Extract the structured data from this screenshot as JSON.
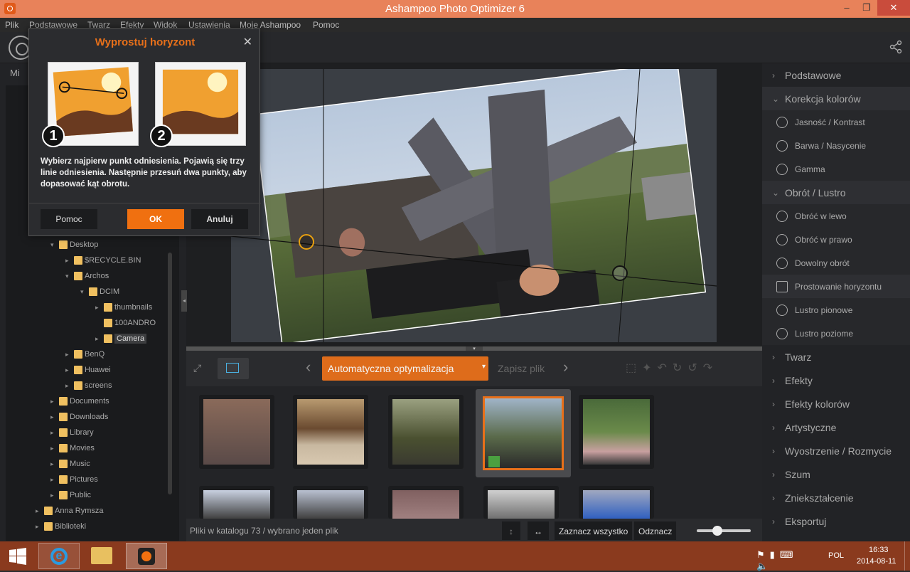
{
  "window": {
    "title": "Ashampoo Photo Optimizer 6"
  },
  "menu": [
    "Plik",
    "Podstawowe",
    "Twarz",
    "Efekty",
    "Widok",
    "Ustawienia",
    "Moje Ashampoo",
    "Pomoc"
  ],
  "dialog": {
    "title": "Wyprostuj horyzont",
    "step1": "1",
    "step2": "2",
    "text": "Wybierz najpierw punkt odniesienia. Pojawią się trzy linie odniesienia. Następnie przesuń dwa punkty, aby dopasować kąt obrotu.",
    "btn_help": "Pomoc",
    "btn_ok": "OK",
    "btn_cancel": "Anuluj"
  },
  "left": {
    "tab_partial": "Mi",
    "tree": [
      {
        "label": "Desktop",
        "depth": 3,
        "arrow": "▾"
      },
      {
        "label": "$RECYCLE.BIN",
        "depth": 4,
        "arrow": "▸"
      },
      {
        "label": "Archos",
        "depth": 4,
        "arrow": "▾"
      },
      {
        "label": "DCIM",
        "depth": 5,
        "arrow": "▾"
      },
      {
        "label": "thumbnails",
        "depth": 6,
        "arrow": "▸"
      },
      {
        "label": "100ANDRO",
        "depth": 6,
        "arrow": ""
      },
      {
        "label": "Camera",
        "depth": 6,
        "arrow": "▸",
        "selected": true
      },
      {
        "label": "BenQ",
        "depth": 4,
        "arrow": "▸"
      },
      {
        "label": "Huawei",
        "depth": 4,
        "arrow": "▸"
      },
      {
        "label": "screens",
        "depth": 4,
        "arrow": "▸"
      },
      {
        "label": "Documents",
        "depth": 3,
        "arrow": "▸"
      },
      {
        "label": "Downloads",
        "depth": 3,
        "arrow": "▸"
      },
      {
        "label": "Library",
        "depth": 3,
        "arrow": "▸"
      },
      {
        "label": "Movies",
        "depth": 3,
        "arrow": "▸"
      },
      {
        "label": "Music",
        "depth": 3,
        "arrow": "▸"
      },
      {
        "label": "Pictures",
        "depth": 3,
        "arrow": "▸"
      },
      {
        "label": "Public",
        "depth": 3,
        "arrow": "▸"
      },
      {
        "label": "Anna Rymsza",
        "depth": 2,
        "arrow": "▸"
      },
      {
        "label": "Biblioteki",
        "depth": 2,
        "arrow": "▸"
      }
    ]
  },
  "toolbar": {
    "auto_label": "Automatyczna optymalizacja",
    "save_label": "Zapisz plik"
  },
  "status": {
    "text": "Pliki w katalogu 73 / wybrano jeden plik",
    "select_all": "Zaznacz wszystko",
    "deselect": "Odznacz"
  },
  "right": {
    "basic": "Podstawowe",
    "color_corr": "Korekcja kolorów",
    "brightness": "Jasność / Kontrast",
    "hue": "Barwa / Nasycenie",
    "gamma": "Gamma",
    "rotate_mirror": "Obrót / Lustro",
    "rot_left": "Obróć w lewo",
    "rot_right": "Obróć w prawo",
    "free_rot": "Dowolny obrót",
    "straighten": "Prostowanie horyzontu",
    "mirror_v": "Lustro pionowe",
    "mirror_h": "Lustro poziome",
    "face": "Twarz",
    "effects": "Efekty",
    "color_effects": "Efekty kolorów",
    "artistic": "Artystyczne",
    "sharpen": "Wyostrzenie / Rozmycie",
    "noise": "Szum",
    "distort": "Zniekształcenie",
    "export": "Eksportuj"
  },
  "tray": {
    "lang": "POL",
    "time": "16:33",
    "date": "2014-08-11"
  },
  "colors": {
    "accent": "#e8701a",
    "titlebar": "#e8825a",
    "taskbar": "#8a3a1e"
  }
}
